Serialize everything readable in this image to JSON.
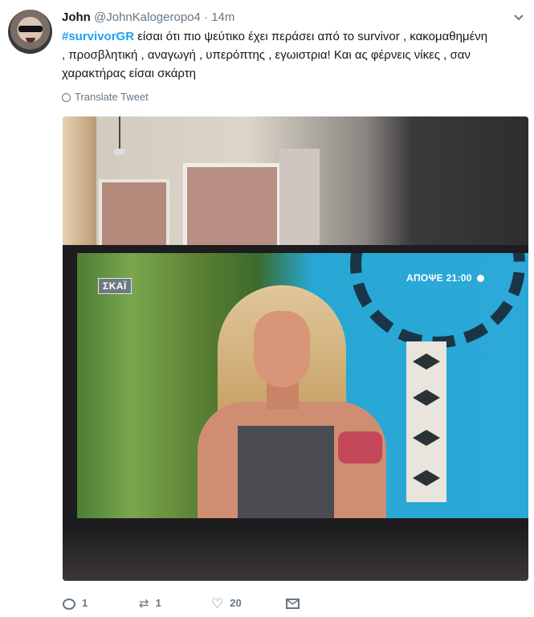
{
  "tweet": {
    "author_name": "John",
    "author_handle": "@JohnKalogeropo4",
    "separator": "·",
    "timestamp": "14m",
    "hashtag": "#survivorGR",
    "body_line1": " είσαι ότι πιο ψεύτικο έχει περάσει από το survivor , κακομαθημένη",
    "body_line2": ", προσβλητική , αναγωγή , υπερόπτης , εγωιστρια! Και ας φέρνεις νίκες , σαν",
    "body_line3": "χαρακτήρας είσαι σκάρτη",
    "translate_label": "Translate Tweet"
  },
  "media": {
    "channel_logo": "ΣΚΑΪ",
    "promo_text": "ΑΠΟΨΕ 21:00"
  },
  "actions": {
    "reply_count": "1",
    "retweet_count": "1",
    "like_count": "20",
    "reply_icon": "reply-icon",
    "retweet_icon": "retweet-icon",
    "like_icon": "heart-icon",
    "dm_icon": "envelope-icon"
  },
  "colors": {
    "accent": "#1da1f2",
    "muted": "#657786",
    "text": "#14171a"
  }
}
